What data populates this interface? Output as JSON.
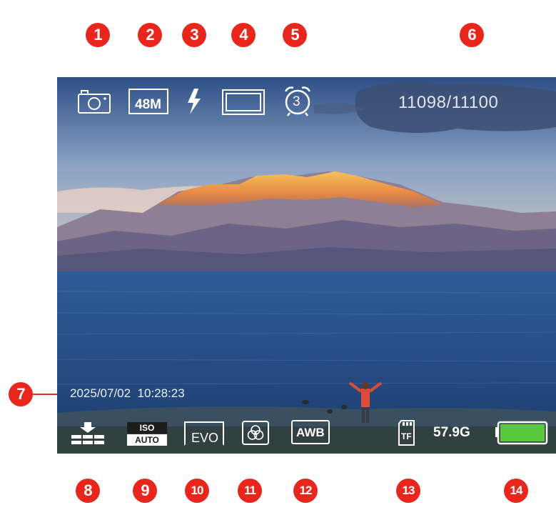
{
  "top_hud": {
    "resolution": "48M",
    "self_timer": "3",
    "shot_counter": "11098/11100"
  },
  "timestamp": "2025/07/02  10:28:23",
  "bottom_hud": {
    "iso_label": "ISO",
    "iso_value": "AUTO",
    "ev_label": "EVO",
    "white_balance": "AWB",
    "storage_label": "TF",
    "storage_free": "57.9G",
    "battery_level": 1.0
  },
  "callouts": [
    "1",
    "2",
    "3",
    "4",
    "5",
    "6",
    "7",
    "8",
    "9",
    "10",
    "11",
    "12",
    "13",
    "14"
  ],
  "icons": {
    "mode": "camera-icon",
    "flash": "flash-auto-icon",
    "aspect": "frame-ratio-icon",
    "timer": "alarm-clock-icon",
    "storage_slot": "sd-card-icon",
    "battery": "battery-icon",
    "color_effect": "color-filter-icon",
    "metering": "metering-icon"
  },
  "colors": {
    "accent": "#e8261c",
    "battery_fill": "#5ac83c",
    "hud": "#ffffff"
  }
}
